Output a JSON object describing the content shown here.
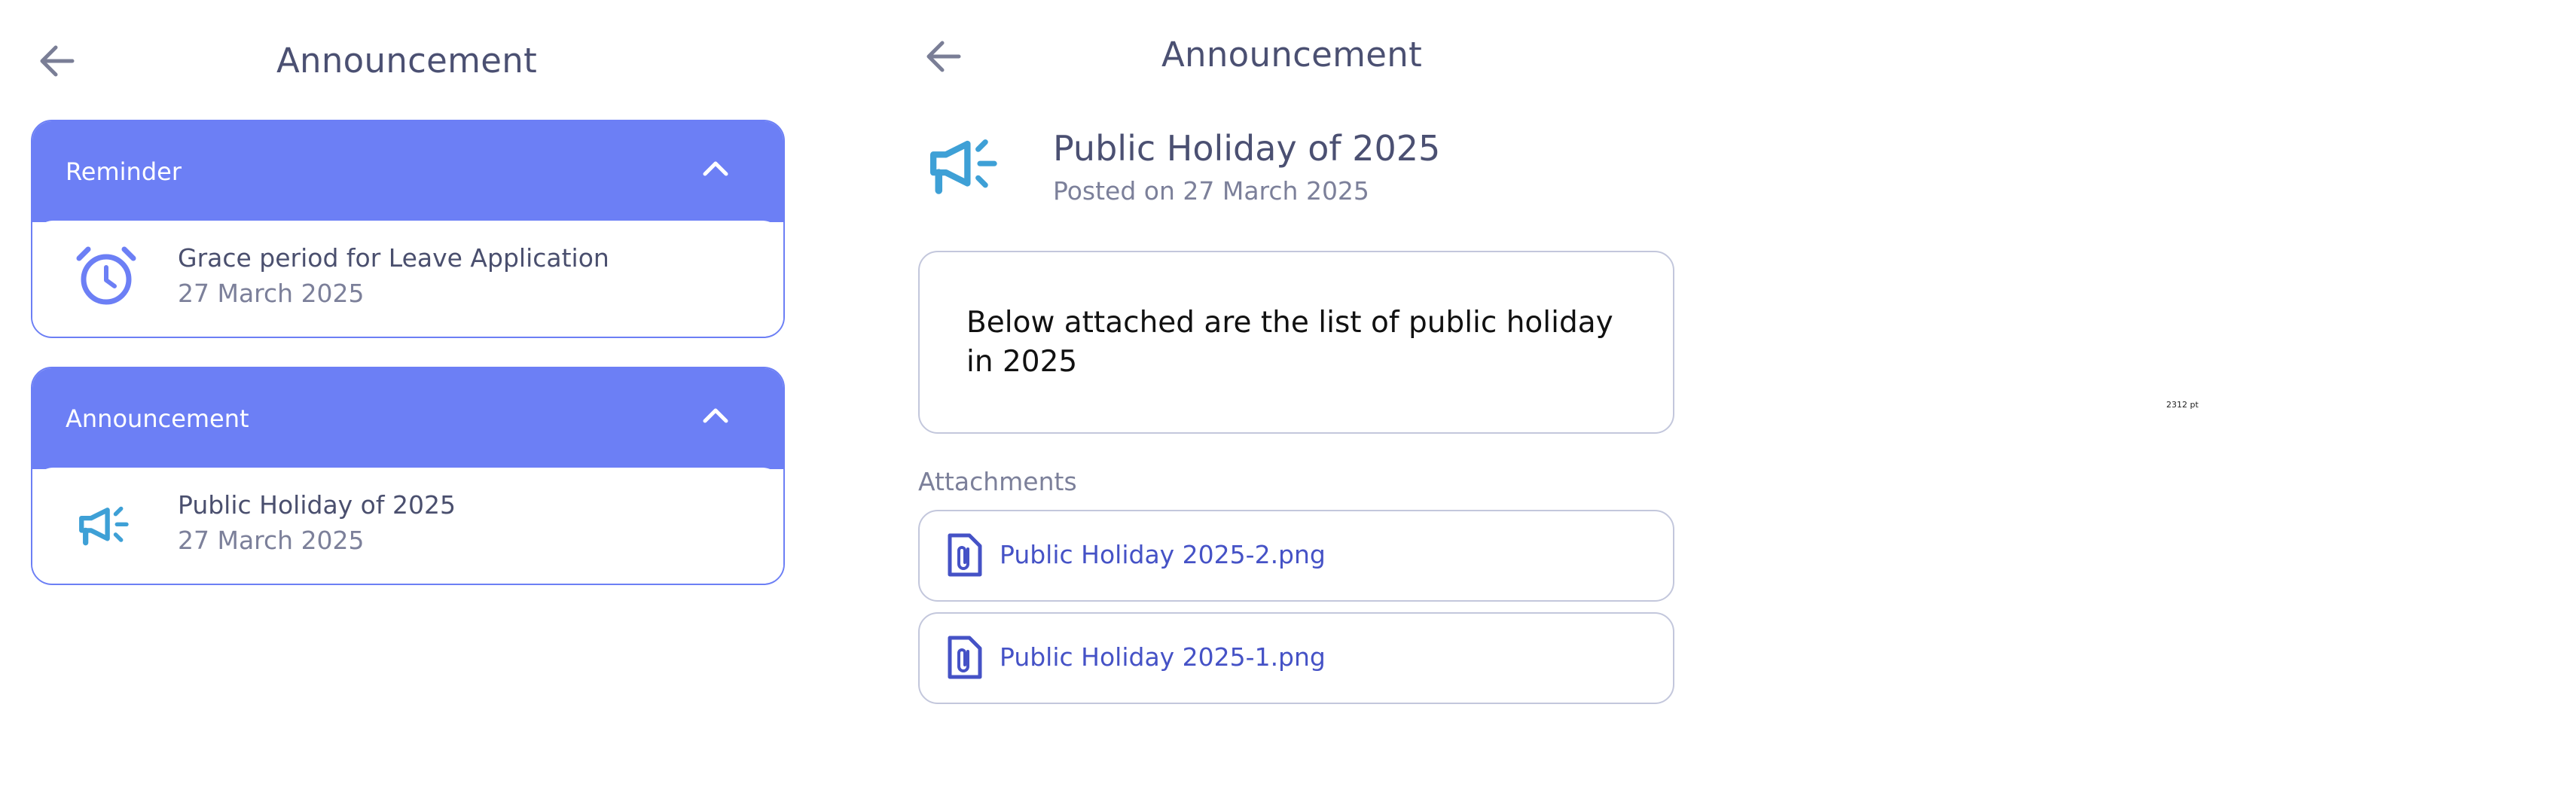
{
  "left_panel": {
    "header": {
      "title": "Announcement"
    },
    "sections": [
      {
        "label": "Reminder",
        "items": [
          {
            "title": "Grace period for Leave Application",
            "date": "27 March 2025",
            "icon": "alarm-clock-icon"
          }
        ]
      },
      {
        "label": "Announcement",
        "items": [
          {
            "title": "Public Holiday of 2025",
            "date": "27 March 2025",
            "icon": "megaphone-icon"
          }
        ]
      }
    ]
  },
  "right_panel": {
    "header": {
      "title": "Announcement"
    },
    "post": {
      "title": "Public Holiday of 2025",
      "posted": "Posted on 27 March 2025",
      "icon": "megaphone-icon",
      "body": "Below attached are the list of public holiday in 2025"
    },
    "attachments_label": "Attachments",
    "attachments": [
      {
        "name": "Public Holiday 2025-2.png",
        "icon": "paperclip-file-icon"
      },
      {
        "name": "Public Holiday 2025-1.png",
        "icon": "paperclip-file-icon"
      }
    ]
  },
  "size_label": "2312 pt",
  "colors": {
    "accent": "#6c7ff5",
    "megaphone": "#3ea0d6",
    "link": "#4552c6",
    "border": "#c3c7dc"
  }
}
